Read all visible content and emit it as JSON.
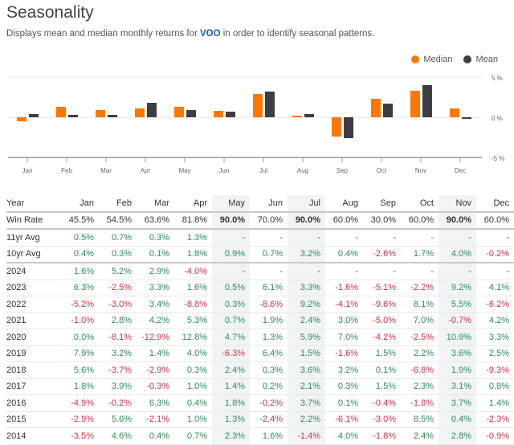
{
  "header": {
    "title": "Seasonality",
    "subtitle_prefix": "Displays mean and median monthly returns for ",
    "ticker": "VOO",
    "subtitle_suffix": " in order to identify seasonal patterns."
  },
  "colors": {
    "median": "#ff7700",
    "mean": "#3d3d42",
    "positive": "#2e8b57",
    "negative": "#cc3344"
  },
  "chart_data": {
    "type": "bar",
    "title": "",
    "categories": [
      "Jan",
      "Feb",
      "Mar",
      "Apr",
      "May",
      "Jun",
      "Jul",
      "Aug",
      "Sep",
      "Oct",
      "Nov",
      "Dec"
    ],
    "series": [
      {
        "name": "Median",
        "values": [
          -0.5,
          1.3,
          0.9,
          1.1,
          1.3,
          0.8,
          2.9,
          0.2,
          -2.4,
          2.3,
          3.3,
          1.1
        ]
      },
      {
        "name": "Mean",
        "values": [
          0.4,
          0.3,
          0.3,
          1.8,
          0.9,
          0.7,
          3.2,
          0.4,
          -2.6,
          1.7,
          4.0,
          -0.2
        ]
      }
    ],
    "ytick_labels": [
      "5 %",
      "0 %",
      "-5 %"
    ],
    "yticks": [
      5,
      0,
      -5
    ],
    "ylim": [
      -5,
      5
    ],
    "xlabel": "",
    "ylabel": "",
    "legend": {
      "position": "top-right",
      "entries": [
        "Median",
        "Mean"
      ]
    },
    "grid": true
  },
  "table": {
    "columns": [
      "Year",
      "Jan",
      "Feb",
      "Mar",
      "Apr",
      "May",
      "Jun",
      "Jul",
      "Aug",
      "Sep",
      "Oct",
      "Nov",
      "Dec"
    ],
    "highlighted_columns": [
      "May",
      "Jul",
      "Nov"
    ],
    "rows": [
      {
        "label": "Win Rate",
        "values": [
          "45.5%",
          "54.5%",
          "63.6%",
          "81.8%",
          "90.0%",
          "70.0%",
          "90.0%",
          "60.0%",
          "30.0%",
          "60.0%",
          "90.0%",
          "60.0%"
        ]
      },
      {
        "label": "11yr Avg",
        "values": [
          "0.5%",
          "0.7%",
          "0.3%",
          "1.3%",
          "-",
          "-",
          "-",
          "-",
          "-",
          "-",
          "-",
          "-"
        ]
      },
      {
        "label": "10yr Avg",
        "values": [
          "0.4%",
          "0.3%",
          "0.1%",
          "1.8%",
          "0.9%",
          "0.7%",
          "3.2%",
          "0.4%",
          "-2.6%",
          "1.7%",
          "4.0%",
          "-0.2%"
        ]
      },
      {
        "label": "2024",
        "values": [
          "1.6%",
          "5.2%",
          "2.9%",
          "-4.0%",
          "-",
          "-",
          "-",
          "-",
          "-",
          "-",
          "-",
          "-"
        ]
      },
      {
        "label": "2023",
        "values": [
          "6.3%",
          "-2.5%",
          "3.3%",
          "1.6%",
          "0.5%",
          "6.1%",
          "3.3%",
          "-1.6%",
          "-5.1%",
          "-2.2%",
          "9.2%",
          "4.1%"
        ]
      },
      {
        "label": "2022",
        "values": [
          "-5.2%",
          "-3.0%",
          "3.4%",
          "-8.8%",
          "0.3%",
          "-8.6%",
          "9.2%",
          "-4.1%",
          "-9.6%",
          "8.1%",
          "5.5%",
          "-6.2%"
        ]
      },
      {
        "label": "2021",
        "values": [
          "-1.0%",
          "2.8%",
          "4.2%",
          "5.3%",
          "0.7%",
          "1.9%",
          "2.4%",
          "3.0%",
          "-5.0%",
          "7.0%",
          "-0.7%",
          "4.2%"
        ]
      },
      {
        "label": "2020",
        "values": [
          "0.0%",
          "-8.1%",
          "-12.9%",
          "12.8%",
          "4.7%",
          "1.3%",
          "5.9%",
          "7.0%",
          "-4.2%",
          "-2.5%",
          "10.9%",
          "3.3%"
        ]
      },
      {
        "label": "2019",
        "values": [
          "7.9%",
          "3.2%",
          "1.4%",
          "4.0%",
          "-6.3%",
          "6.4%",
          "1.5%",
          "-1.6%",
          "1.5%",
          "2.2%",
          "3.6%",
          "2.5%"
        ]
      },
      {
        "label": "2018",
        "values": [
          "5.6%",
          "-3.7%",
          "-2.9%",
          "0.3%",
          "2.4%",
          "0.3%",
          "3.6%",
          "3.2%",
          "0.1%",
          "-6.8%",
          "1.9%",
          "-9.3%"
        ]
      },
      {
        "label": "2017",
        "values": [
          "1.8%",
          "3.9%",
          "-0.3%",
          "1.0%",
          "1.4%",
          "0.2%",
          "2.1%",
          "0.3%",
          "1.5%",
          "2.3%",
          "3.1%",
          "0.8%"
        ]
      },
      {
        "label": "2016",
        "values": [
          "-4.9%",
          "-0.2%",
          "6.3%",
          "0.4%",
          "1.8%",
          "-0.2%",
          "3.7%",
          "0.1%",
          "-0.4%",
          "-1.8%",
          "3.7%",
          "1.4%"
        ]
      },
      {
        "label": "2015",
        "values": [
          "-2.9%",
          "5.6%",
          "-2.1%",
          "1.0%",
          "1.3%",
          "-2.4%",
          "2.2%",
          "-6.1%",
          "-3.0%",
          "8.5%",
          "0.4%",
          "-2.3%"
        ]
      },
      {
        "label": "2014",
        "values": [
          "-3.5%",
          "4.6%",
          "0.4%",
          "0.7%",
          "2.3%",
          "1.6%",
          "-1.4%",
          "4.0%",
          "-1.8%",
          "2.4%",
          "2.8%",
          "-0.9%"
        ]
      }
    ]
  }
}
